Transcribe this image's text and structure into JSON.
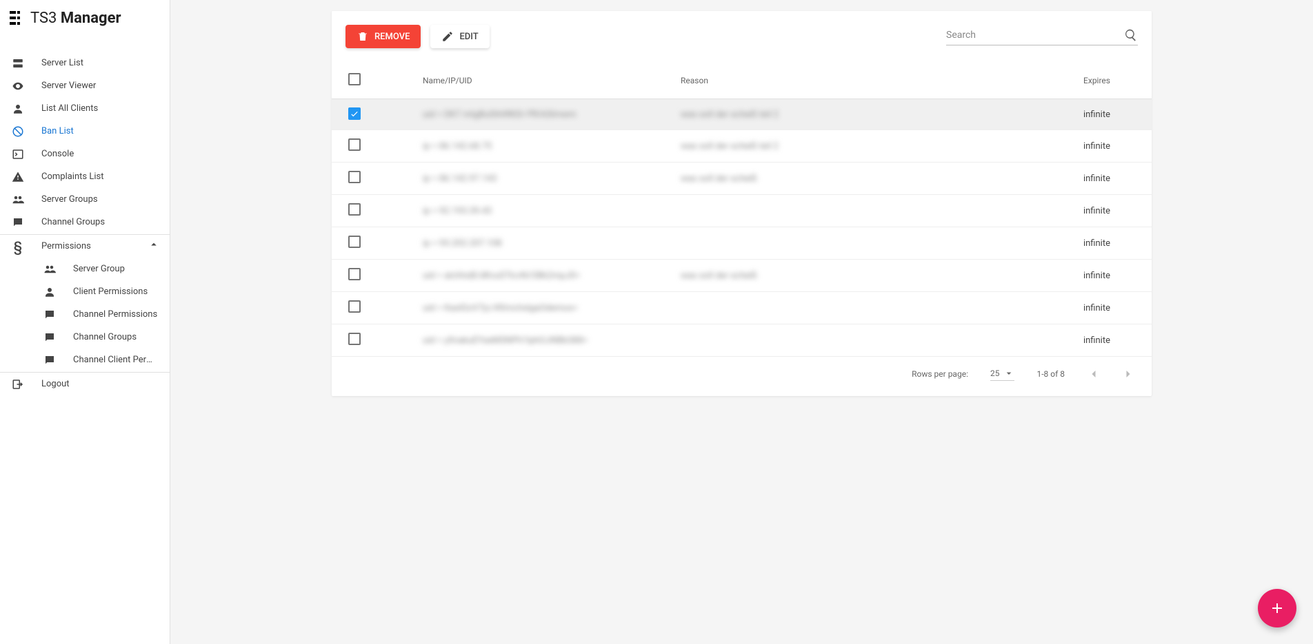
{
  "app": {
    "title_light": "TS3",
    "title_bold": "Manager"
  },
  "sidebar": {
    "items": [
      {
        "label": "Server List",
        "icon": "dns"
      },
      {
        "label": "Server Viewer",
        "icon": "eye"
      },
      {
        "label": "List All Clients",
        "icon": "person"
      },
      {
        "label": "Ban List",
        "icon": "ban",
        "active": true
      },
      {
        "label": "Console",
        "icon": "terminal"
      },
      {
        "label": "Complaints List",
        "icon": "warning"
      },
      {
        "label": "Server Groups",
        "icon": "group"
      },
      {
        "label": "Channel Groups",
        "icon": "chat"
      },
      {
        "label": "Permissions",
        "icon": "section",
        "expandable": true,
        "expanded": true
      }
    ],
    "sub_items": [
      {
        "label": "Server Group",
        "icon": "group"
      },
      {
        "label": "Client Permissions",
        "icon": "person"
      },
      {
        "label": "Channel Permissions",
        "icon": "chat"
      },
      {
        "label": "Channel Groups",
        "icon": "chat"
      },
      {
        "label": "Channel Client Permissio…",
        "icon": "chat"
      }
    ],
    "logout": "Logout"
  },
  "toolbar": {
    "remove_label": "Remove",
    "edit_label": "Edit",
    "search_placeholder": "Search"
  },
  "table": {
    "columns": {
      "name": "Name/IP/UID",
      "reason": "Reason",
      "expires": "Expires"
    },
    "rows": [
      {
        "selected": true,
        "name": "uid = DK7 mtgBuShhRKDr PR/kSlmwm",
        "reason": "was soll der scheiß teil 2",
        "expires": "infinite"
      },
      {
        "selected": false,
        "name": "ip = 86.142.68.75",
        "reason": "was soll der scheiß teil 2",
        "expires": "infinite"
      },
      {
        "selected": false,
        "name": "ip = 86.142.97.143",
        "reason": "was soll der scheiß",
        "expires": "infinite"
      },
      {
        "selected": false,
        "name": "ip = 92.193.39.43",
        "reason": "",
        "expires": "infinite"
      },
      {
        "selected": false,
        "name": "ip = 93.202.207.108",
        "reason": "",
        "expires": "infinite"
      },
      {
        "selected": false,
        "name": "uid = alchhsB/dKvu07lcvN/OBk2mpJ0=",
        "reason": "was soll der scheiß",
        "expires": "infinite"
      },
      {
        "selected": false,
        "name": "uid = KaslGoV7jc/#XmchslgaOdemos=",
        "reason": "",
        "expires": "infinite"
      },
      {
        "selected": false,
        "name": "uid = yXvakuEYseMSNPh1lphOJNBb388=",
        "reason": "",
        "expires": "infinite"
      }
    ]
  },
  "footer": {
    "rows_per_page_label": "Rows per page:",
    "rows_per_page_value": "25",
    "range_label": "1-8 of 8"
  }
}
